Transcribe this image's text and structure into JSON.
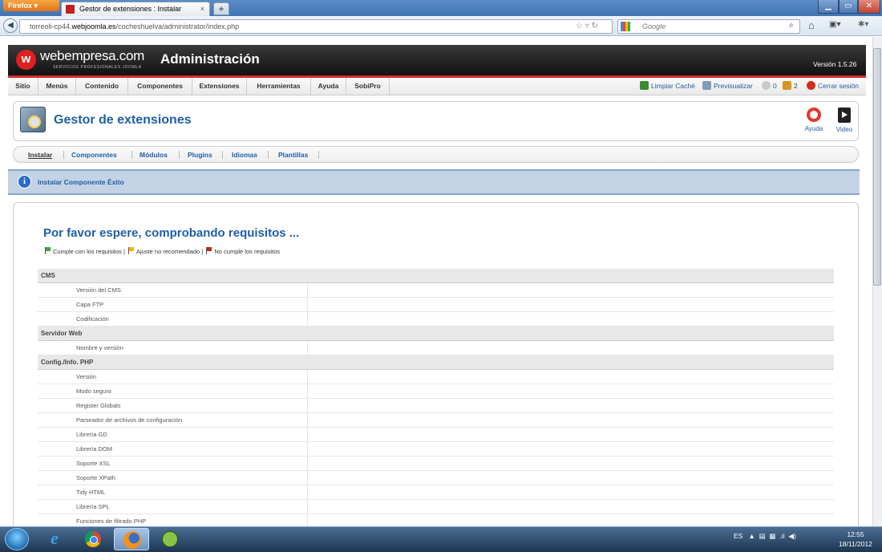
{
  "browser": {
    "menu_button": "Firefox ▾",
    "tab_title": "Gestor de extensiones : Instalar",
    "new_tab": "+",
    "url_prefix": "torreoli-cp44.",
    "url_domain": "webjoomla.es",
    "url_rest": "/cocheshuelva/administrator/index.php",
    "search_placeholder": "Google",
    "icons": [
      "back-icon",
      "star-icon",
      "reload-icon",
      "google-icon",
      "search-icon",
      "home-icon",
      "bookmarks-icon",
      "addons-icon"
    ]
  },
  "joomla": {
    "logo_text": "webempresa.com",
    "logo_subtitle": "SERVICIOS PROFESIONALES JOOMLA",
    "admin_title": "Administración",
    "version": "Versión 1.5.26",
    "menu": [
      "Sitio",
      "Menús",
      "Contenido",
      "Componentes",
      "Extensiones",
      "Herramientas",
      "Ayuda",
      "SobiPro"
    ],
    "topright": {
      "clear_cache": "Limpiar Caché",
      "preview": "Previsualizar",
      "messages_count": "0",
      "users_count": "2",
      "logout": "Cerrar sesión"
    },
    "page_title": "Gestor de extensiones",
    "toolbar": {
      "help": "Ayuda",
      "video": "Video"
    },
    "subtabs": [
      "Instalar",
      "Componentes",
      "Módulos",
      "Plugins",
      "Idiomas",
      "Plantillas"
    ],
    "message": "Instalar Componente Éxito",
    "requirements": {
      "title": "Por favor espere, comprobando requisitos ...",
      "legend": {
        "ok": "Cumple con los requisitos |",
        "warn": "Ajuste no recomendado |",
        "fail": "No cumple los requisitos"
      },
      "sections": [
        {
          "name": "CMS",
          "items": [
            "Versión del CMS",
            "Capa FTP",
            "Codificación"
          ]
        },
        {
          "name": "Servidor Web",
          "items": [
            "Nombre y versión"
          ]
        },
        {
          "name": "Config./Info. PHP",
          "items": [
            "Versión",
            "Modo seguro",
            "Register Globals",
            "Parseador de archivos de configuración",
            "Librería GD",
            "Librería DOM",
            "Soporte XSL",
            "Soporte XPath",
            "Tidy HTML",
            "Librería SPL",
            "Funciones de filtrado PHP"
          ]
        }
      ]
    }
  },
  "taskbar": {
    "lang": "ES",
    "time": "12:55",
    "date": "18/11/2012"
  }
}
